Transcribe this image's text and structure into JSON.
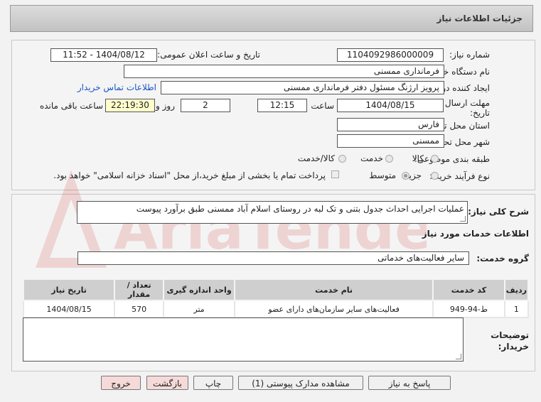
{
  "page_title": "جزئیات اطلاعات نیاز",
  "watermark_text": "AriaTender.net",
  "fields": {
    "need_number_label": "شماره نیاز:",
    "need_number": "1104092986000009",
    "announce_datetime_label": "تاریخ و ساعت اعلان عمومی:",
    "announce_datetime": "1404/08/12 - 11:52",
    "buyer_org_label": "نام دستگاه خریدار:",
    "buyer_org": "فرمانداری ممسنی",
    "requester_label": "ایجاد کننده درخواست:",
    "requester": "پرویز ارژنگ مسئول دفتر فرمانداری ممسنی",
    "contact_link": "اطلاعات تماس خریدار",
    "deadline_label_1": "مهلت ارسال پاسخ: تا",
    "deadline_label_2": "تاریخ:",
    "deadline_date": "1404/08/15",
    "time_label": "ساعت",
    "deadline_time": "12:15",
    "days_count": "2",
    "days_and_label": "روز و",
    "remaining_time": "22:19:30",
    "remaining_label": "ساعت باقی مانده",
    "province_label": "استان محل تحویل:",
    "province": "فارس",
    "city_label": "شهر محل تحویل:",
    "city": "ممسنی",
    "category_label": "طبقه بندی موضوعی:",
    "category_options": [
      "کالا",
      "خدمت",
      "کالا/خدمت"
    ],
    "category_selected": "خدمت",
    "process_label": "نوع فرآیند خرید :",
    "process_options": [
      "جزیی",
      "متوسط"
    ],
    "process_selected": "متوسط",
    "payment_note": "پرداخت تمام یا بخشی از مبلغ خرید،از محل \"اسناد خزانه اسلامی\" خواهد بود."
  },
  "summary": {
    "label": "شرح کلی نیاز:",
    "text": "عملیات اجرایی احداث جدول بتنی و تک لبه در روستای اسلام آباد ممسنی طبق برآورد پیوست"
  },
  "services_section_title": "اطلاعات خدمات مورد نیاز",
  "service_group": {
    "label": "گروه خدمت:",
    "value": "سایر فعالیت‌های خدماتی"
  },
  "table": {
    "headers": [
      "ردیف",
      "کد خدمت",
      "نام خدمت",
      "واحد اندازه گیری",
      "تعداد / مقدار",
      "تاریخ نیاز"
    ],
    "rows": [
      [
        "1",
        "ط-94-949",
        "فعالیت‌های سایر سازمان‌های دارای عضو",
        "متر",
        "570",
        "1404/08/15"
      ]
    ]
  },
  "buyer_notes_label_1": "توضیحات",
  "buyer_notes_label_2": "خریدار:",
  "buttons": {
    "reply": "پاسخ به نیاز",
    "attachments": "مشاهده مدارک پیوستی (1)",
    "print": "چاپ",
    "back": "بازگشت",
    "exit": "خروج"
  }
}
